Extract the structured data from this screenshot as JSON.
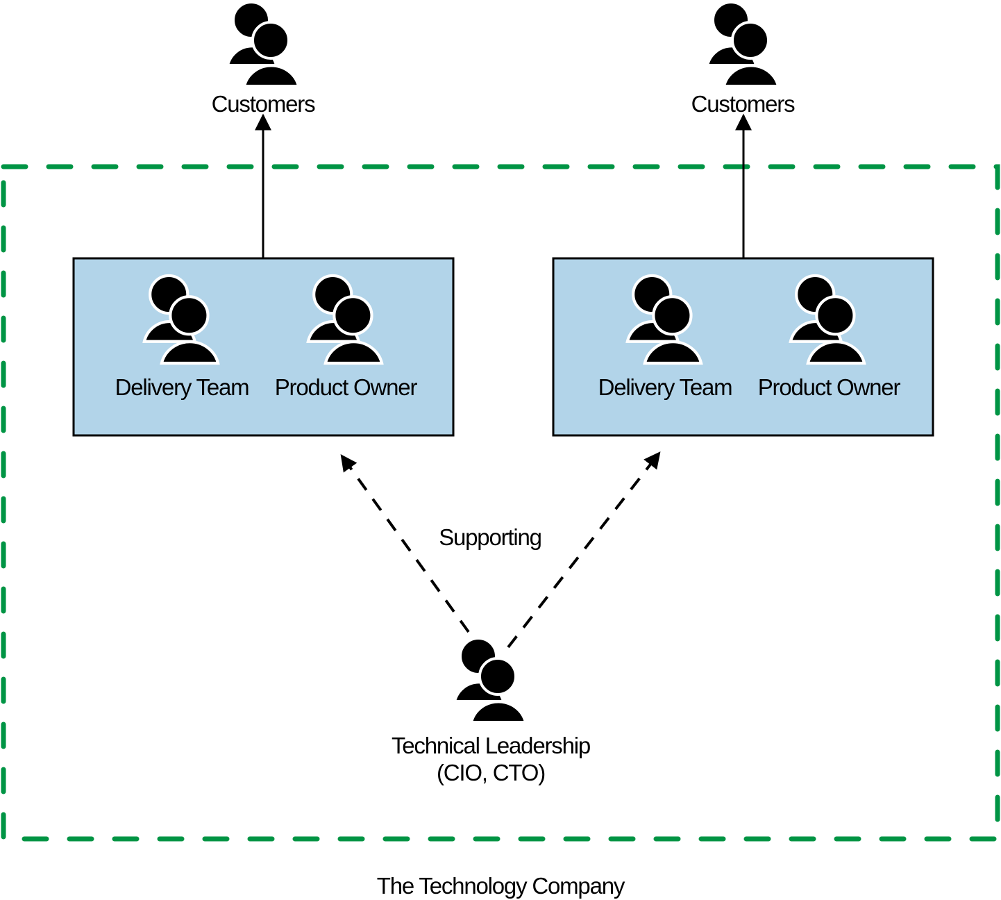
{
  "diagram": {
    "title": "The Technology Company",
    "colors": {
      "company_border": "#009444",
      "team_fill": "#b2d4e9",
      "team_border": "#000000",
      "arrow": "#000000",
      "icon": "#000000"
    },
    "customers": [
      {
        "label": "Customers",
        "icon": "people-group-icon"
      },
      {
        "label": "Customers",
        "icon": "people-group-icon"
      }
    ],
    "teams": [
      {
        "members": [
          {
            "label": "Delivery Team",
            "icon": "people-group-icon"
          },
          {
            "label": "Product Owner",
            "icon": "people-group-icon"
          }
        ]
      },
      {
        "members": [
          {
            "label": "Delivery Team",
            "icon": "people-group-icon"
          },
          {
            "label": "Product Owner",
            "icon": "people-group-icon"
          }
        ]
      }
    ],
    "relationship_label": "Supporting",
    "leadership": {
      "label_line1": "Technical Leadership",
      "label_line2": "(CIO, CTO)",
      "icon": "people-group-icon"
    },
    "edges": [
      {
        "from": "team-1",
        "to": "customers-1",
        "style": "solid"
      },
      {
        "from": "team-2",
        "to": "customers-2",
        "style": "solid"
      },
      {
        "from": "leadership",
        "to": "team-1",
        "style": "dashed",
        "label": "Supporting"
      },
      {
        "from": "leadership",
        "to": "team-2",
        "style": "dashed",
        "label": "Supporting"
      }
    ]
  }
}
